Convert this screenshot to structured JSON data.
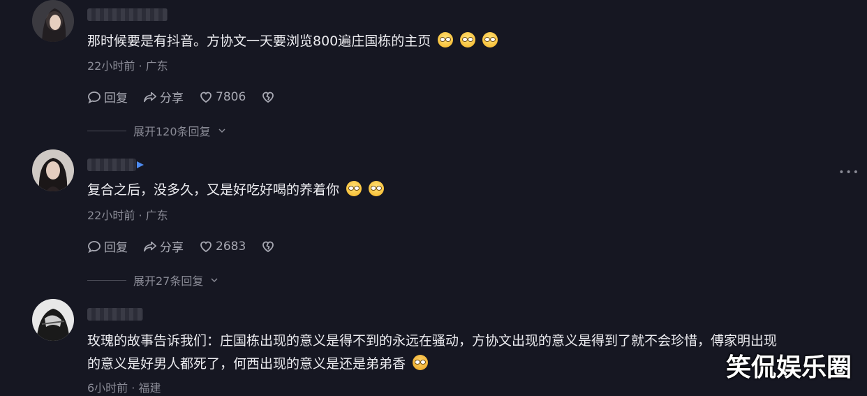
{
  "comments": [
    {
      "text": "那时候要是有抖音。方协文一天要浏览800遍庄国栋的主页",
      "meta": "22小时前 · 广东",
      "reply_label": "回复",
      "share_label": "分享",
      "likes": "7806",
      "expand_label": "展开120条回复"
    },
    {
      "text": "复合之后，没多久，又是好吃好喝的养着你",
      "meta": "22小时前 · 广东",
      "reply_label": "回复",
      "share_label": "分享",
      "likes": "2683",
      "expand_label": "展开27条回复"
    },
    {
      "text_line1": "玫瑰的故事告诉我们：庄国栋出现的意义是得不到的永远在骚动，方协文出现的意义是得到了就不会珍惜，傅家明出现",
      "text_line2": "的意义是好男人都死了，何西出现的意义是还是弟弟香",
      "meta": "6小时前 · 福建"
    }
  ],
  "more_menu": "•••",
  "watermark": "笑侃娱乐圈",
  "colors": {
    "background": "#161722",
    "text": "#ececf0",
    "secondary": "#8a8b96",
    "verified": "#4d8bf0"
  }
}
